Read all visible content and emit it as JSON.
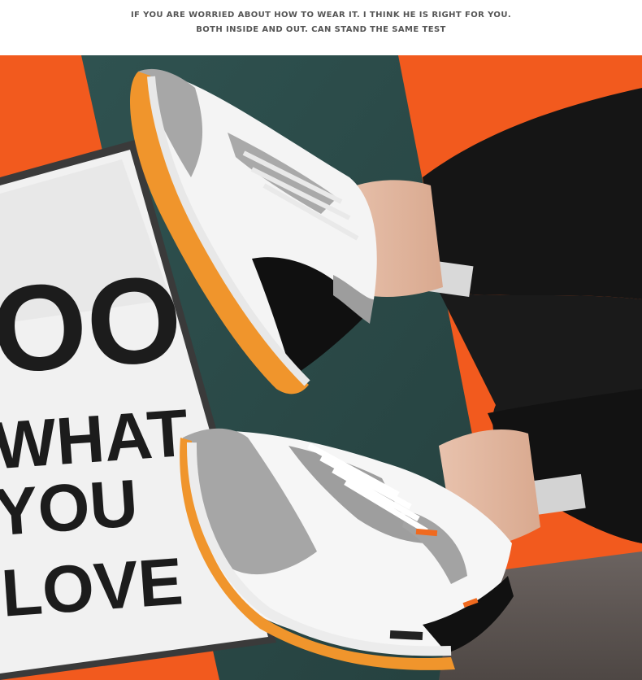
{
  "caption": {
    "line1": "IF YOU ARE WORRIED ABOUT HOW TO WEAR IT. I THINK HE IS RIGHT FOR YOU.",
    "line2": "BOTH INSIDE AND OUT. CAN STAND THE SAME TEST"
  },
  "poster": {
    "line1": "OO",
    "line2": "WHAT",
    "line3": "YOU",
    "line4": "LOVE"
  },
  "colors": {
    "orange": "#f25a1e",
    "teal": "#2e4d4b",
    "sole": "#f0952c",
    "grey_suede": "#a8a8a8",
    "pants": "#151515"
  }
}
